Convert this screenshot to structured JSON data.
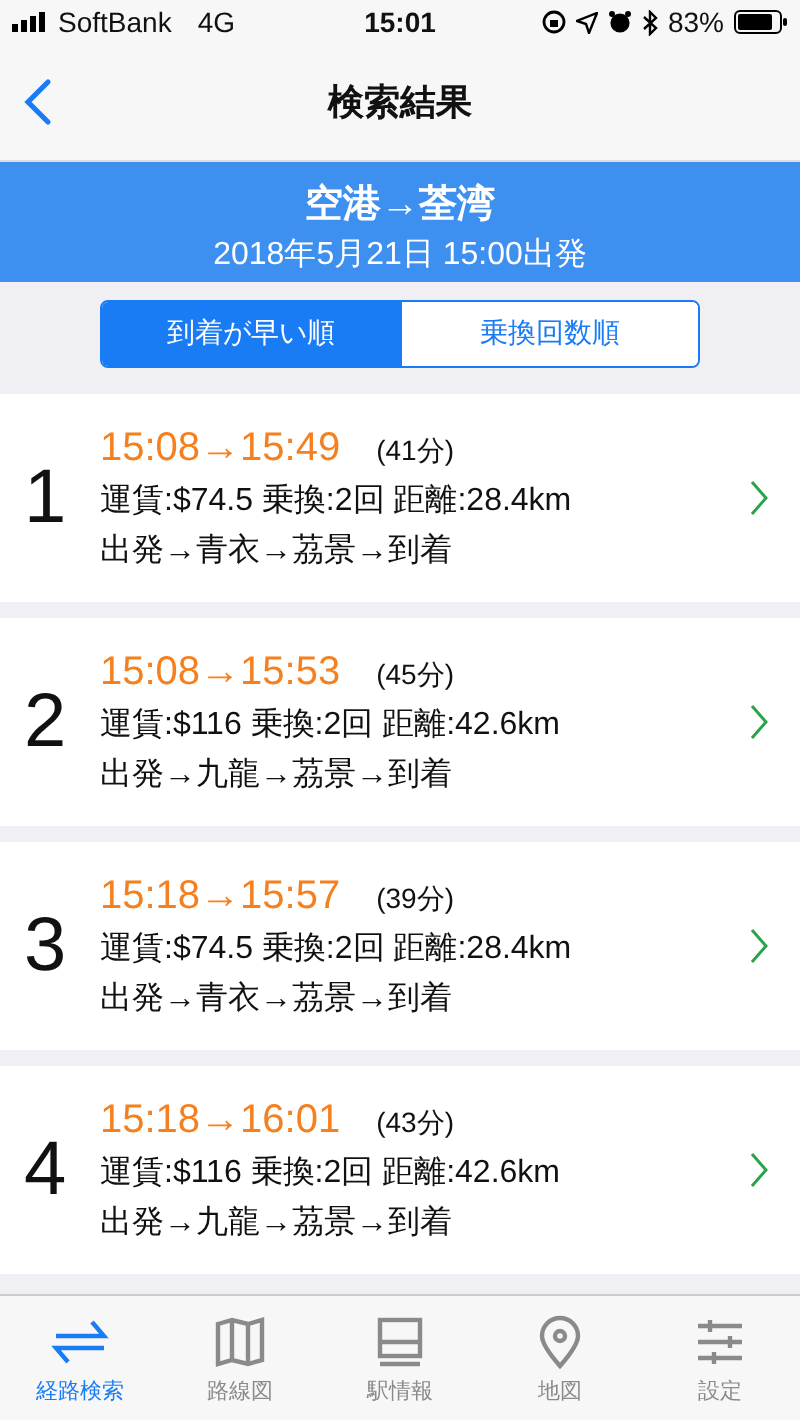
{
  "status_bar": {
    "carrier": "SoftBank",
    "network": "4G",
    "time": "15:01",
    "battery": "83%"
  },
  "nav": {
    "title": "検索結果"
  },
  "banner": {
    "route": "空港→荃湾",
    "departure": "2018年5月21日 15:00出発"
  },
  "sort_tabs": [
    {
      "label": "到着が早い順",
      "selected": true
    },
    {
      "label": "乗換回数順",
      "selected": false
    }
  ],
  "results": [
    {
      "number": "1",
      "times": "15:08→15:49",
      "duration": "(41分)",
      "details": "運賃:$74.5 乗換:2回 距離:28.4km",
      "path": "出発→青衣→茘景→到着"
    },
    {
      "number": "2",
      "times": "15:08→15:53",
      "duration": "(45分)",
      "details": "運賃:$116 乗換:2回 距離:42.6km",
      "path": "出発→九龍→茘景→到着"
    },
    {
      "number": "3",
      "times": "15:18→15:57",
      "duration": "(39分)",
      "details": "運賃:$74.5 乗換:2回 距離:28.4km",
      "path": "出発→青衣→茘景→到着"
    },
    {
      "number": "4",
      "times": "15:18→16:01",
      "duration": "(43分)",
      "details": "運賃:$116 乗換:2回 距離:42.6km",
      "path": "出発→九龍→茘景→到着"
    }
  ],
  "tab_bar": [
    {
      "kind": "route",
      "label": "経路検索",
      "selected": true
    },
    {
      "kind": "map",
      "label": "路線図",
      "selected": false
    },
    {
      "kind": "station",
      "label": "駅情報",
      "selected": false
    },
    {
      "kind": "pin",
      "label": "地図",
      "selected": false
    },
    {
      "kind": "settings",
      "label": "設定",
      "selected": false
    }
  ]
}
